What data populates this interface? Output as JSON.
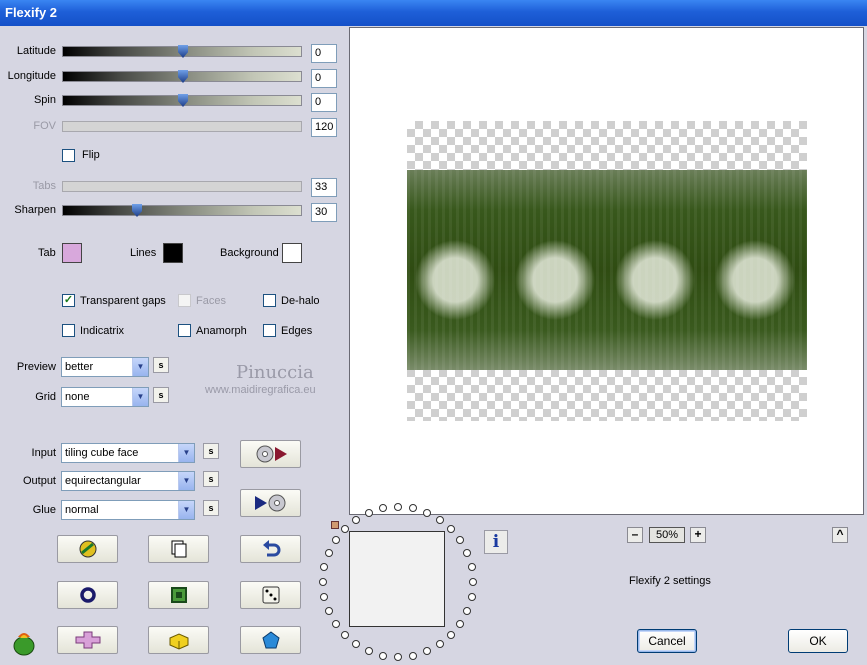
{
  "window": {
    "title": "Flexify 2"
  },
  "sliders": [
    {
      "label": "Latitude",
      "value": "0",
      "enabled": true,
      "position": 0.5
    },
    {
      "label": "Longitude",
      "value": "0",
      "enabled": true,
      "position": 0.5
    },
    {
      "label": "Spin",
      "value": "0",
      "enabled": true,
      "position": 0.5
    },
    {
      "label": "FOV",
      "value": "120",
      "enabled": false
    },
    {
      "label": "Tabs",
      "value": "33",
      "enabled": false
    },
    {
      "label": "Sharpen",
      "value": "30",
      "enabled": true,
      "position": 0.3
    }
  ],
  "flip": {
    "label": "Flip",
    "checked": false
  },
  "colors": {
    "tab": {
      "label": "Tab",
      "value": "#d8a8dc"
    },
    "lines": {
      "label": "Lines",
      "value": "#000000"
    },
    "background": {
      "label": "Background",
      "value": "#ffffff"
    }
  },
  "options": {
    "transparent_gaps": {
      "label": "Transparent gaps",
      "checked": true
    },
    "faces": {
      "label": "Faces",
      "checked": false
    },
    "dehalo": {
      "label": "De-halo",
      "checked": false
    },
    "indicatrix": {
      "label": "Indicatrix",
      "checked": false
    },
    "anamorph": {
      "label": "Anamorph",
      "checked": false
    },
    "edges": {
      "label": "Edges",
      "checked": false
    }
  },
  "selects": {
    "preview": {
      "label": "Preview",
      "value": "better"
    },
    "grid": {
      "label": "Grid",
      "value": "none"
    },
    "input": {
      "label": "Input",
      "value": "tiling cube face"
    },
    "output": {
      "label": "Output",
      "value": "equirectangular"
    },
    "glue": {
      "label": "Glue",
      "value": "normal"
    }
  },
  "s_button_label": "s",
  "watermark": {
    "name": "Pinuccia",
    "url": "www.maidiregrafica.eu"
  },
  "preview": {
    "zoom": "50%",
    "zoom_minus": "–",
    "zoom_plus": "+",
    "up": "^"
  },
  "settings_text": "Flexify 2 settings",
  "info_label": "i",
  "buttons": {
    "cancel": "Cancel",
    "ok": "OK"
  },
  "icons": [
    "convert-input-icon",
    "convert-output-icon",
    "randomize-icon",
    "copy-icon",
    "undo-icon",
    "ring-icon",
    "square-icon",
    "dice-icon",
    "cross-icon",
    "brick-icon",
    "pentagon-icon",
    "flaming-pear-logo-icon"
  ]
}
